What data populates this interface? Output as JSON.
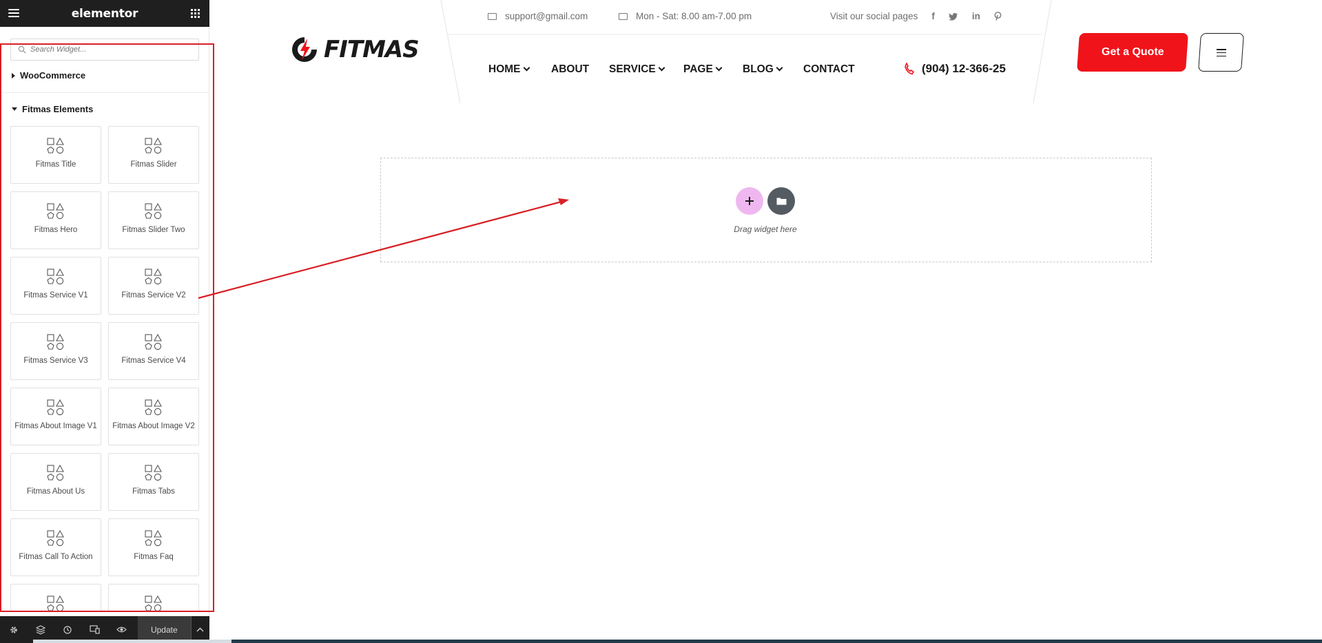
{
  "editor": {
    "logo": "elementor",
    "search_placeholder": "Search Widget...",
    "categories": [
      {
        "label": "WooCommerce",
        "expanded": false
      },
      {
        "label": "Fitmas Elements",
        "expanded": true
      }
    ],
    "widgets": [
      "Fitmas Title",
      "Fitmas Slider",
      "Fitmas Hero",
      "Fitmas Slider Two",
      "Fitmas Service V1",
      "Fitmas Service V2",
      "Fitmas Service V3",
      "Fitmas Service V4",
      "Fitmas About Image V1",
      "Fitmas About Image V2",
      "Fitmas About Us",
      "Fitmas Tabs",
      "Fitmas Call To Action",
      "Fitmas Faq",
      "",
      ""
    ],
    "footer": {
      "update_label": "Update",
      "icons": [
        "settings-icon",
        "layers-icon",
        "history-icon",
        "responsive-icon",
        "preview-icon",
        "chevron-up-icon"
      ]
    }
  },
  "site": {
    "brand": "FITMAS",
    "topbar": {
      "email": "support@gmail.com",
      "hours": "Mon - Sat: 8.00 am-7.00 pm",
      "social_label": "Visit our social pages",
      "social_icons": [
        "facebook-icon",
        "twitter-icon",
        "linkedin-icon",
        "pinterest-icon"
      ]
    },
    "nav": [
      {
        "label": "HOME",
        "dropdown": true
      },
      {
        "label": "ABOUT",
        "dropdown": false
      },
      {
        "label": "SERVICE",
        "dropdown": true
      },
      {
        "label": "PAGE",
        "dropdown": true
      },
      {
        "label": "BLOG",
        "dropdown": true
      },
      {
        "label": "CONTACT",
        "dropdown": false
      }
    ],
    "phone": "(904) 12-366-25",
    "quote_button": "Get a Quote"
  },
  "canvas": {
    "drop_hint": "Drag widget here"
  },
  "colors": {
    "accent_red": "#f0131a",
    "annotation_red": "#d81f26",
    "add_button": "#efb7f0",
    "template_button": "#555b62",
    "panel_dark": "#1f1f1f"
  }
}
